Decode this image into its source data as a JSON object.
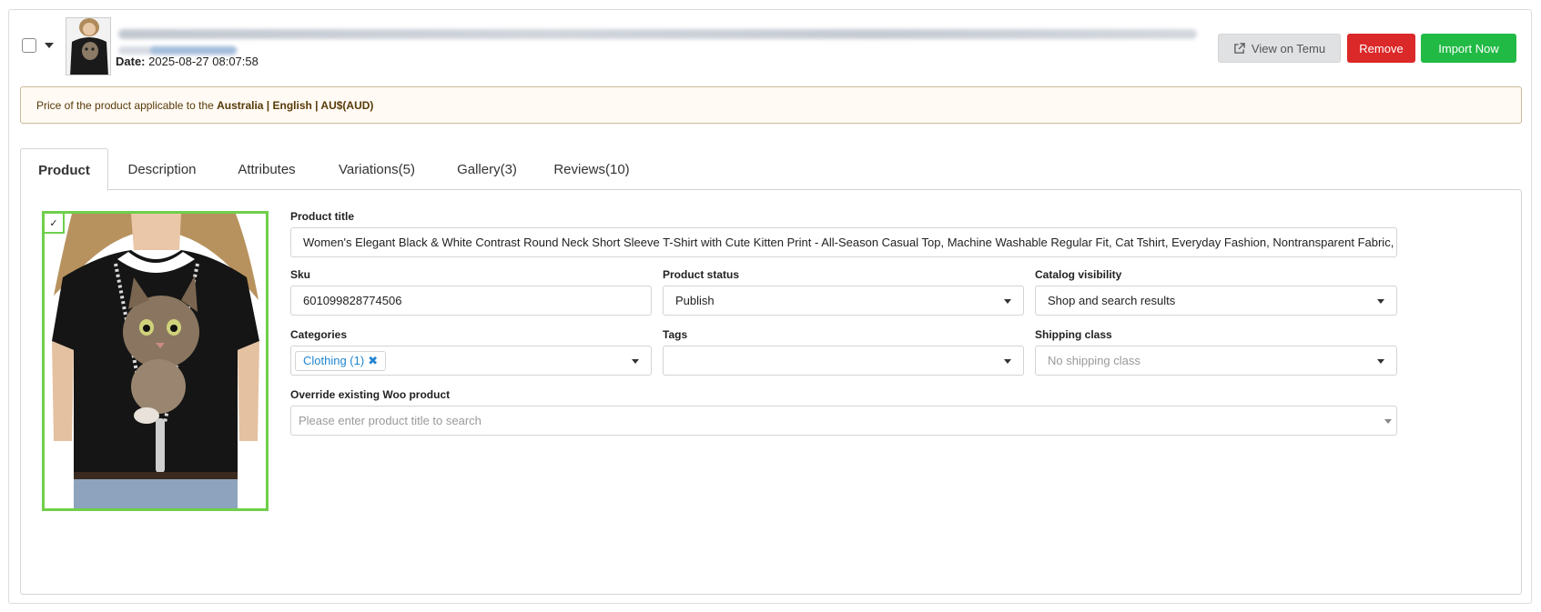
{
  "header": {
    "date_label": "Date:",
    "date_value": "2025-08-27 08:07:58",
    "buttons": {
      "view": "View on Temu",
      "remove": "Remove",
      "import": "Import Now"
    }
  },
  "notice": {
    "prefix": "Price of the product applicable to the ",
    "region": "Australia | English | AU$(AUD)"
  },
  "tabs": [
    {
      "label": "Product",
      "active": true
    },
    {
      "label": "Description"
    },
    {
      "label": "Attributes"
    },
    {
      "label": "Variations(5)"
    },
    {
      "label": "Gallery(3)"
    },
    {
      "label": "Reviews(10)"
    }
  ],
  "product": {
    "image_check": "✓",
    "title_label": "Product title",
    "title_value": "Women's Elegant Black & White Contrast Round Neck Short Sleeve T-Shirt with Cute Kitten Print - All-Season Casual Top, Machine Washable Regular Fit, Cat Tshirt, Everyday Fashion, Nontransparent Fabric, Versatile Clothing, M",
    "sku_label": "Sku",
    "sku_value": "601099828774506",
    "status_label": "Product status",
    "status_value": "Publish",
    "visibility_label": "Catalog visibility",
    "visibility_value": "Shop and search results",
    "categories_label": "Categories",
    "category_chip": "Clothing (1)",
    "tags_label": "Tags",
    "tags_value": "",
    "shipping_label": "Shipping class",
    "shipping_placeholder": "No shipping class",
    "override_label": "Override existing Woo product",
    "override_placeholder": "Please enter product title to search"
  },
  "colors": {
    "remove": "#db2828",
    "import": "#21ba45",
    "image_border": "#6fcf4b",
    "chip_text": "#2185d0"
  }
}
